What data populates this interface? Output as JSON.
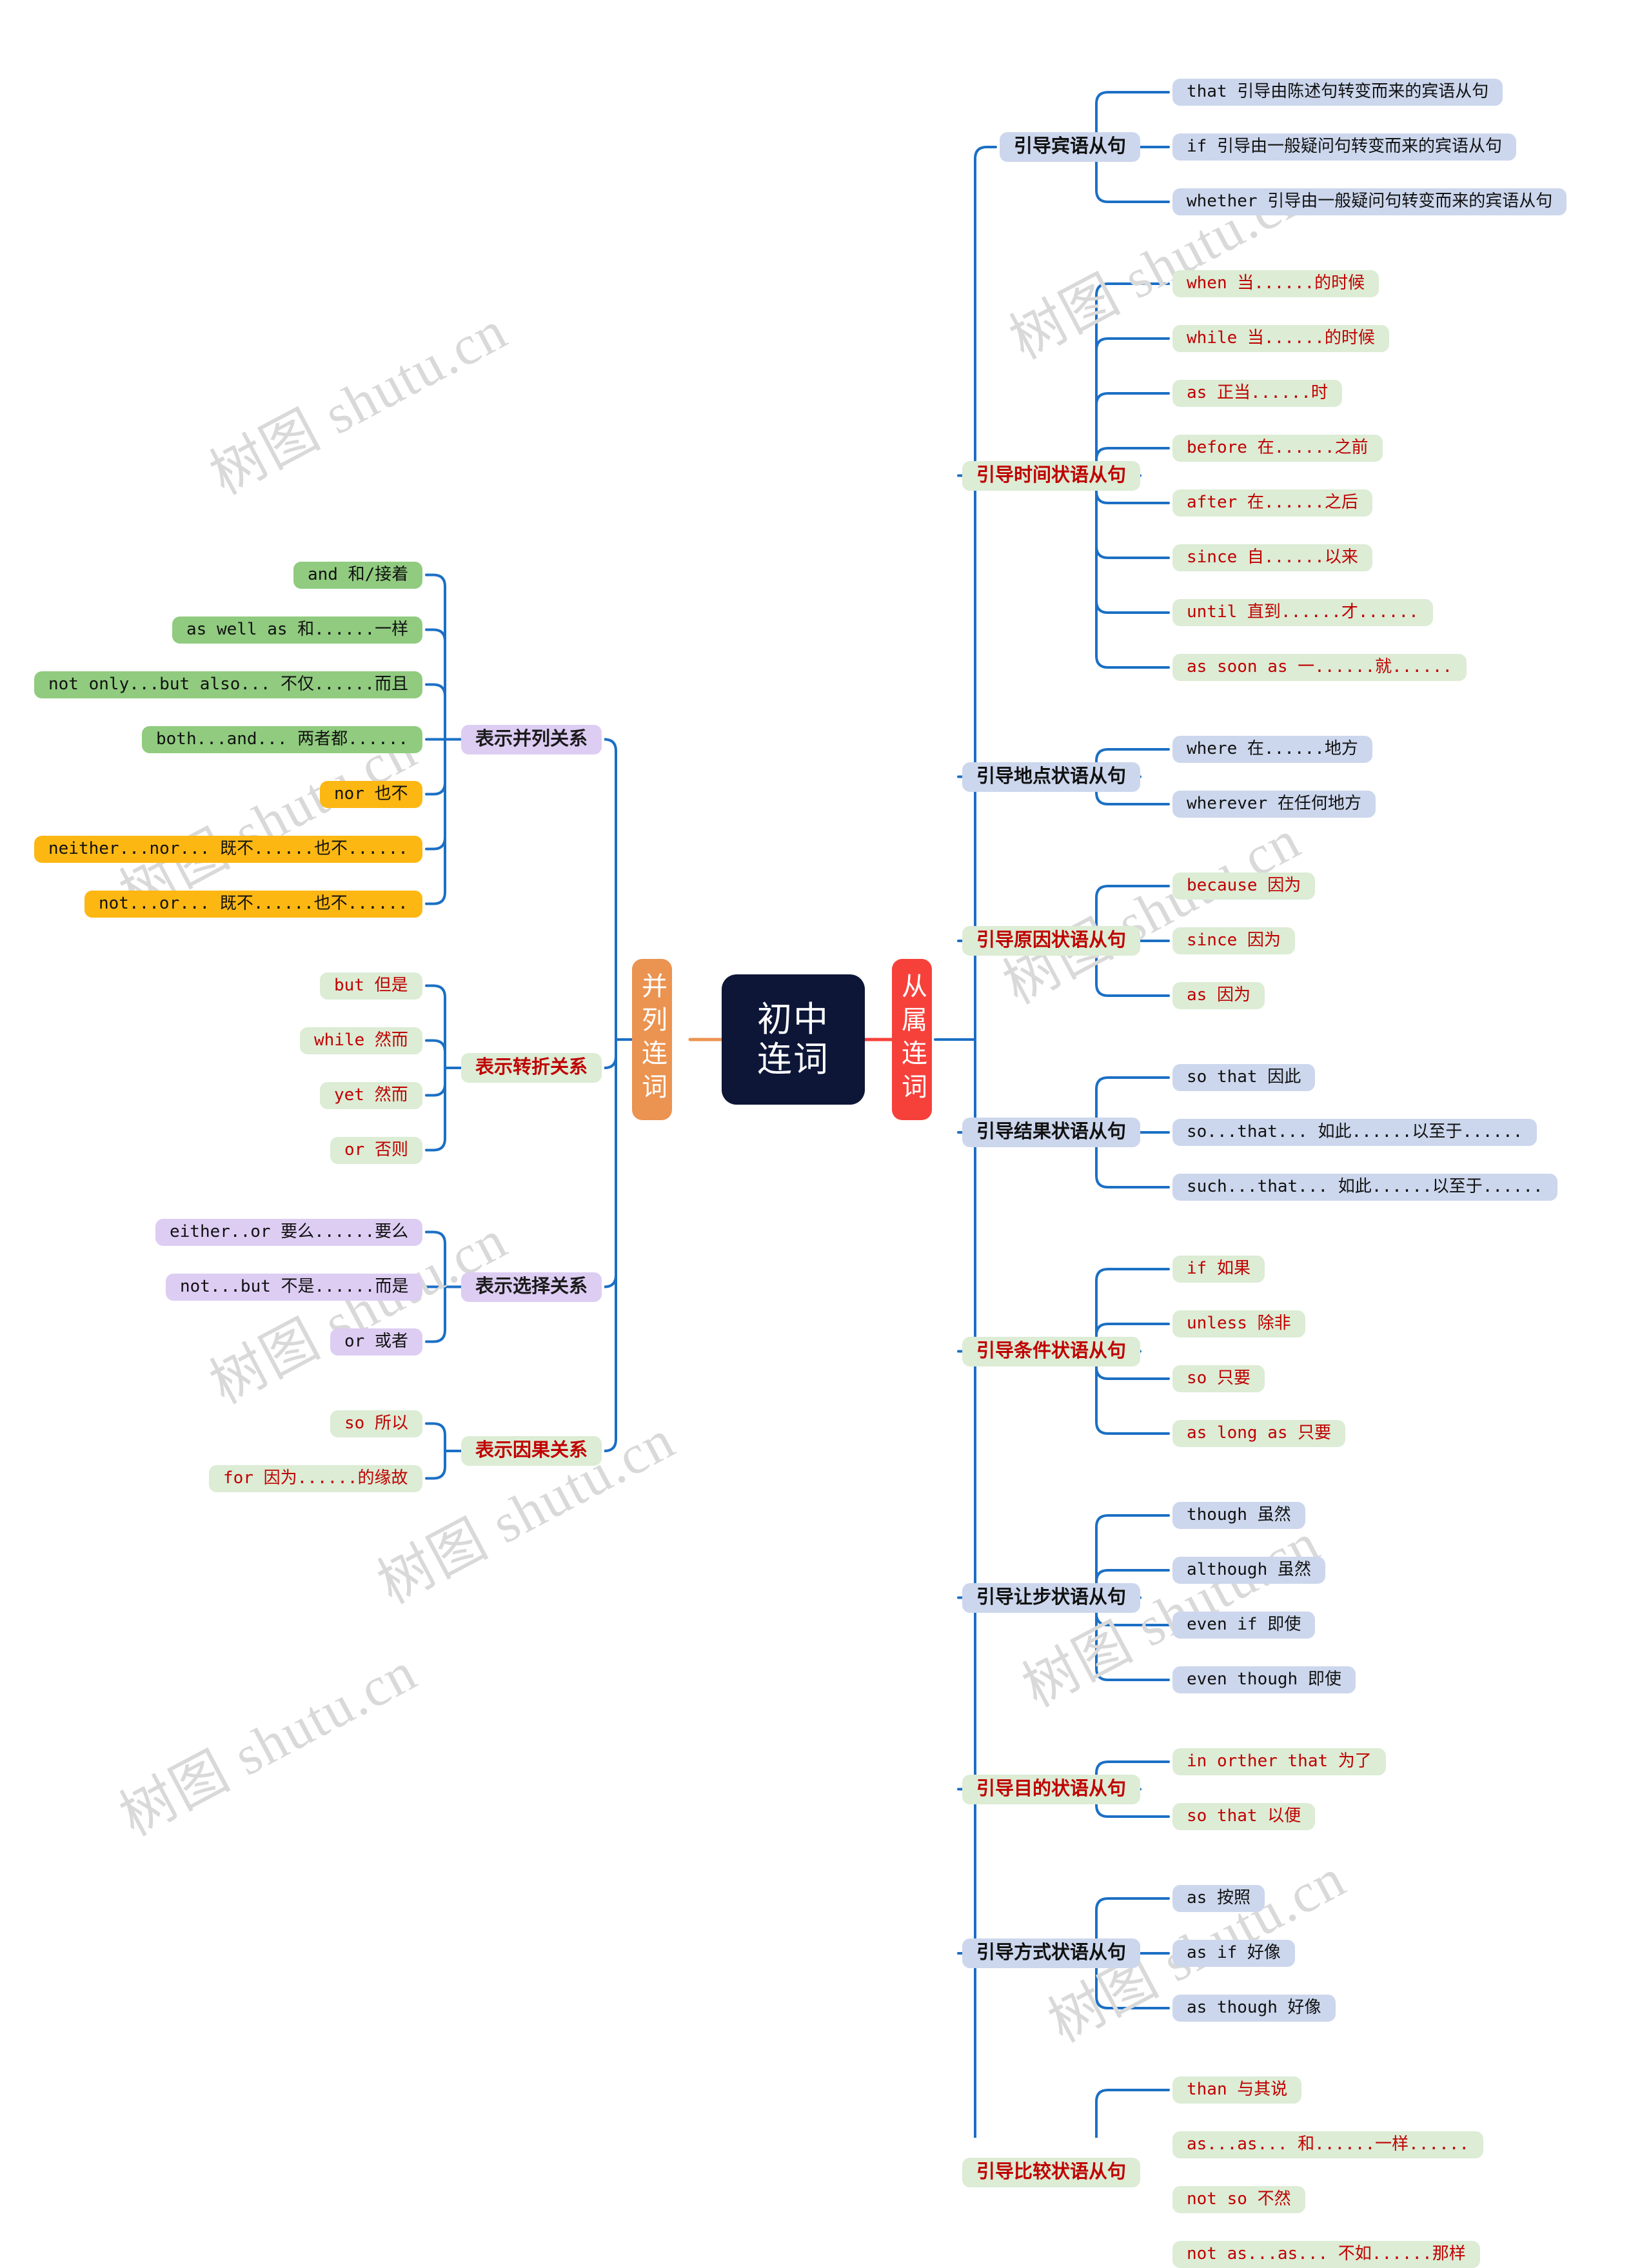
{
  "meta": {
    "watermark_text": "树图 shutu.cn",
    "colors": {
      "root_bg": "#0d1637",
      "root_fg": "#ffffff",
      "orange": "#eb9350",
      "red": "#f6413b",
      "purple": "#ddcdf3",
      "light_green": "#dcecd5",
      "light_blue": "#ccd7ed",
      "strong_green": "#90cb7f",
      "amber": "#fcb713",
      "link": "#1b6fc4",
      "red_text": "#c00000"
    }
  },
  "root": {
    "line1": "初中",
    "line2": "连词"
  },
  "left_branch": {
    "label": "并列连词",
    "groups": [
      {
        "label": "表示并列关系",
        "label_style": "purple",
        "items": [
          {
            "text": "and 和/接着",
            "style": "green-b"
          },
          {
            "text": "as well as 和......一样",
            "style": "green-b"
          },
          {
            "text": "not only...but also... 不仅......而且",
            "style": "green-b"
          },
          {
            "text": "both...and... 两者都......",
            "style": "green-b"
          },
          {
            "text": "nor 也不",
            "style": "orange-b"
          },
          {
            "text": "neither...nor... 既不......也不......",
            "style": "orange-b"
          },
          {
            "text": "not...or... 既不......也不......",
            "style": "orange-b"
          }
        ]
      },
      {
        "label": "表示转折关系",
        "label_style": "green",
        "items": [
          {
            "text": "but 但是",
            "style": "pgreen"
          },
          {
            "text": "while 然而",
            "style": "pgreen"
          },
          {
            "text": "yet 然而",
            "style": "pgreen"
          },
          {
            "text": "or 否则",
            "style": "pgreen"
          }
        ]
      },
      {
        "label": "表示选择关系",
        "label_style": "purple",
        "items": [
          {
            "text": "either..or 要么......要么",
            "style": "purple"
          },
          {
            "text": "not...but 不是......而是",
            "style": "purple"
          },
          {
            "text": "or 或者",
            "style": "purple"
          }
        ]
      },
      {
        "label": "表示因果关系",
        "label_style": "green",
        "items": [
          {
            "text": "so 所以",
            "style": "pgreen"
          },
          {
            "text": "for 因为......的缘故",
            "style": "pgreen"
          }
        ]
      }
    ]
  },
  "right_branch": {
    "label": "从属连词",
    "groups": [
      {
        "label": "引导宾语从句",
        "label_style": "blue",
        "items": [
          {
            "text": "that 引导由陈述句转变而来的宾语从句",
            "style": "pblue"
          },
          {
            "text": "if 引导由一般疑问句转变而来的宾语从句",
            "style": "pblue"
          },
          {
            "text": "whether 引导由一般疑问句转变而来的宾语从句",
            "style": "pblue"
          }
        ]
      },
      {
        "label": "引导时间状语从句",
        "label_style": "green",
        "items": [
          {
            "text": "when 当......的时候",
            "style": "pgreen"
          },
          {
            "text": "while 当......的时候",
            "style": "pgreen"
          },
          {
            "text": "as 正当......时",
            "style": "pgreen"
          },
          {
            "text": "before 在......之前",
            "style": "pgreen"
          },
          {
            "text": "after 在......之后",
            "style": "pgreen"
          },
          {
            "text": "since 自......以来",
            "style": "pgreen"
          },
          {
            "text": "until 直到......才......",
            "style": "pgreen"
          },
          {
            "text": "as soon as 一......就......",
            "style": "pgreen"
          }
        ]
      },
      {
        "label": "引导地点状语从句",
        "label_style": "blue",
        "items": [
          {
            "text": "where 在......地方",
            "style": "pblue"
          },
          {
            "text": "wherever 在任何地方",
            "style": "pblue"
          }
        ]
      },
      {
        "label": "引导原因状语从句",
        "label_style": "green",
        "items": [
          {
            "text": "because 因为",
            "style": "pgreen"
          },
          {
            "text": "since 因为",
            "style": "pgreen"
          },
          {
            "text": "as 因为",
            "style": "pgreen"
          }
        ]
      },
      {
        "label": "引导结果状语从句",
        "label_style": "blue",
        "items": [
          {
            "text": "so that 因此",
            "style": "pblue"
          },
          {
            "text": "so...that... 如此......以至于......",
            "style": "pblue"
          },
          {
            "text": "such...that... 如此......以至于......",
            "style": "pblue"
          }
        ]
      },
      {
        "label": "引导条件状语从句",
        "label_style": "green",
        "items": [
          {
            "text": "if 如果",
            "style": "pgreen"
          },
          {
            "text": "unless 除非",
            "style": "pgreen"
          },
          {
            "text": "so 只要",
            "style": "pgreen"
          },
          {
            "text": "as long as 只要",
            "style": "pgreen"
          }
        ]
      },
      {
        "label": "引导让步状语从句",
        "label_style": "blue",
        "items": [
          {
            "text": "though 虽然",
            "style": "pblue"
          },
          {
            "text": "although 虽然",
            "style": "pblue"
          },
          {
            "text": "even if 即使",
            "style": "pblue"
          },
          {
            "text": "even though 即使",
            "style": "pblue"
          }
        ]
      },
      {
        "label": "引导目的状语从句",
        "label_style": "green",
        "items": [
          {
            "text": "in orther that 为了",
            "style": "pgreen"
          },
          {
            "text": "so that 以便",
            "style": "pgreen"
          }
        ]
      },
      {
        "label": "引导方式状语从句",
        "label_style": "blue",
        "items": [
          {
            "text": "as 按照",
            "style": "pblue"
          },
          {
            "text": "as if 好像",
            "style": "pblue"
          },
          {
            "text": "as though 好像",
            "style": "pblue"
          }
        ]
      },
      {
        "label": "引导比较状语从句",
        "label_style": "green",
        "items": [
          {
            "text": "than 与其说",
            "style": "pgreen"
          },
          {
            "text": "as...as... 和......一样......",
            "style": "pgreen"
          },
          {
            "text": "not so 不然",
            "style": "pgreen"
          },
          {
            "text": "not as...as... 不如......那样",
            "style": "pgreen"
          }
        ]
      }
    ]
  }
}
